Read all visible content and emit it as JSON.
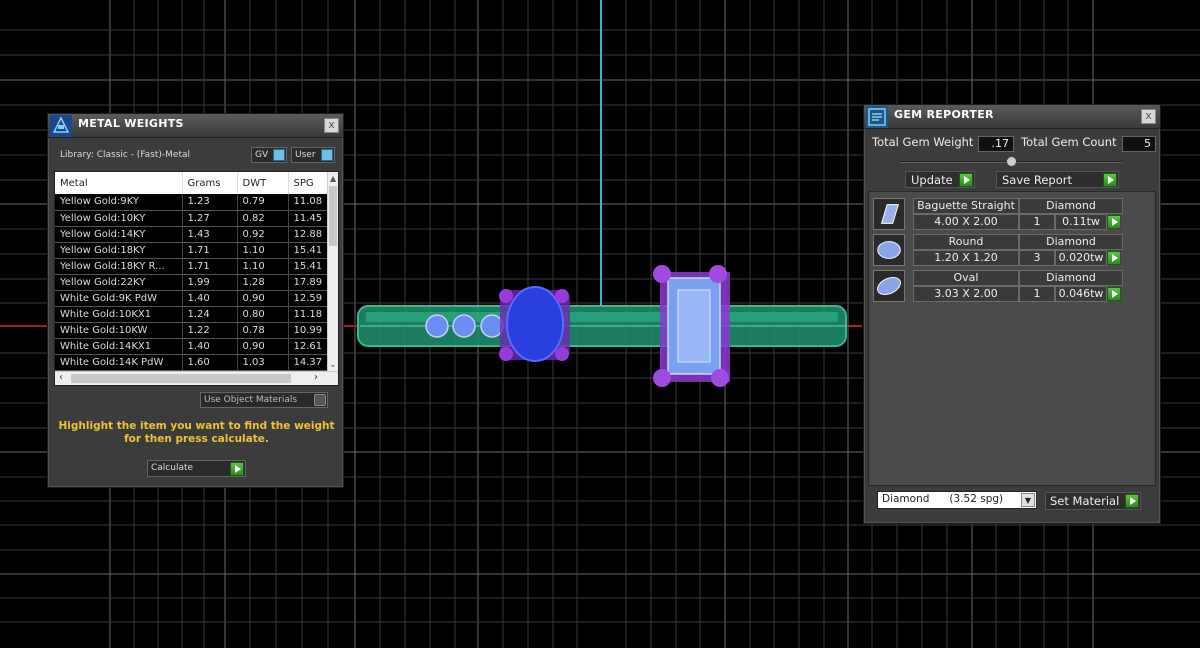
{
  "metal_weights": {
    "title": "METAL WEIGHTS",
    "library": "Library: Classic - (Fast)-Metal",
    "gv_toggle": "GV",
    "user_toggle": "User",
    "columns": [
      "Metal",
      "Grams",
      "DWT",
      "SPG"
    ],
    "rows": [
      [
        "Yellow Gold:9KY",
        "1.23",
        "0.79",
        "11.08"
      ],
      [
        "Yellow Gold:10KY",
        "1.27",
        "0.82",
        "11.45"
      ],
      [
        "Yellow Gold:14KY",
        "1.43",
        "0.92",
        "12.88"
      ],
      [
        "Yellow Gold:18KY",
        "1.71",
        "1.10",
        "15.41"
      ],
      [
        "Yellow Gold:18KY R...",
        "1.71",
        "1.10",
        "15.41"
      ],
      [
        "Yellow Gold:22KY",
        "1.99",
        "1.28",
        "17.89"
      ],
      [
        "White Gold:9K PdW",
        "1.40",
        "0.90",
        "12.59"
      ],
      [
        "White Gold:10KX1",
        "1.24",
        "0.80",
        "11.18"
      ],
      [
        "White Gold:10KW",
        "1.22",
        "0.78",
        "10.99"
      ],
      [
        "White Gold:14KX1",
        "1.40",
        "0.90",
        "12.61"
      ],
      [
        "White Gold:14K PdW",
        "1.60",
        "1.03",
        "14.37"
      ]
    ],
    "use_object_materials": "Use Object Materials",
    "hint": "Highlight the item you want to find the weight for then press calculate.",
    "calculate": "Calculate",
    "close": "x"
  },
  "gem_reporter": {
    "title": "GEM REPORTER",
    "total_weight_label": "Total Gem Weight",
    "total_weight": ".17",
    "total_count_label": "Total Gem Count",
    "total_count": "5",
    "update": "Update",
    "save_report": "Save Report",
    "gems": [
      {
        "shape": "Baguette Straight",
        "material": "Diamond",
        "size": "4.00 X 2.00",
        "count": "1",
        "weight": "0.11tw"
      },
      {
        "shape": "Round",
        "material": "Diamond",
        "size": "1.20 X 1.20",
        "count": "3",
        "weight": "0.020tw"
      },
      {
        "shape": "Oval",
        "material": "Diamond",
        "size": "3.03 X 2.00",
        "count": "1",
        "weight": "0.046tw"
      }
    ],
    "material_select": "Diamond      (3.52 spg)",
    "set_material": "Set Material",
    "close": "x"
  }
}
